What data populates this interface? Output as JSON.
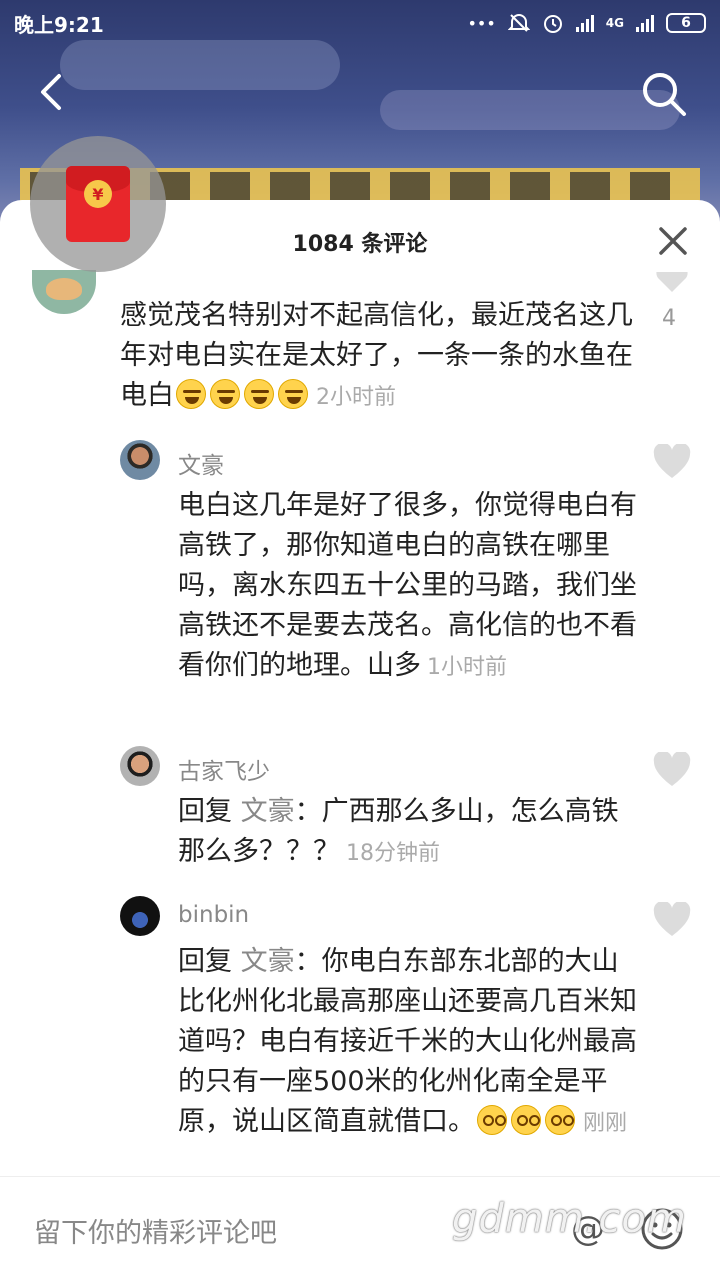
{
  "status_bar": {
    "time": "晚上9:21",
    "network": "4G",
    "battery": "6"
  },
  "nav": {
    "back_icon": "chevron-left-icon",
    "search_icon": "search-icon"
  },
  "sheet": {
    "title": "1084 条评论",
    "close_icon": "close-icon"
  },
  "main_comment": {
    "text": "感觉茂名特别对不起高信化，最近茂名这几年对电白实在是太好了，一条一条的水鱼在电白",
    "time": "2小时前",
    "likes": "4"
  },
  "replies": [
    {
      "name": "文豪",
      "text": "电白这几年是好了很多，你觉得电白有高铁了，那你知道电白的高铁在哪里吗，离水东四五十公里的马踏，我们坐高铁还不是要去茂名。高化信的也不看看你们的地理。山多",
      "time": "1小时前"
    },
    {
      "name": "古家飞少",
      "reply_prefix": "回复",
      "mention": "文豪",
      "text": "：广西那么多山，怎么高铁那么多？？？",
      "time": "18分钟前"
    },
    {
      "name": "binbin",
      "reply_prefix": "回复",
      "mention": "文豪",
      "text": "：你电白东部东北部的大山比化州化北最高那座山还要高几百米知道吗？电白有接近千米的大山化州最高的只有一座500米的化州化南全是平原，说山区简直就借口。",
      "time": "刚刚"
    }
  ],
  "input": {
    "placeholder": "留下你的精彩评论吧"
  },
  "watermark": "gdmm.com",
  "colors": {
    "accent_red": "#e8272b",
    "muted_text": "#888888"
  }
}
